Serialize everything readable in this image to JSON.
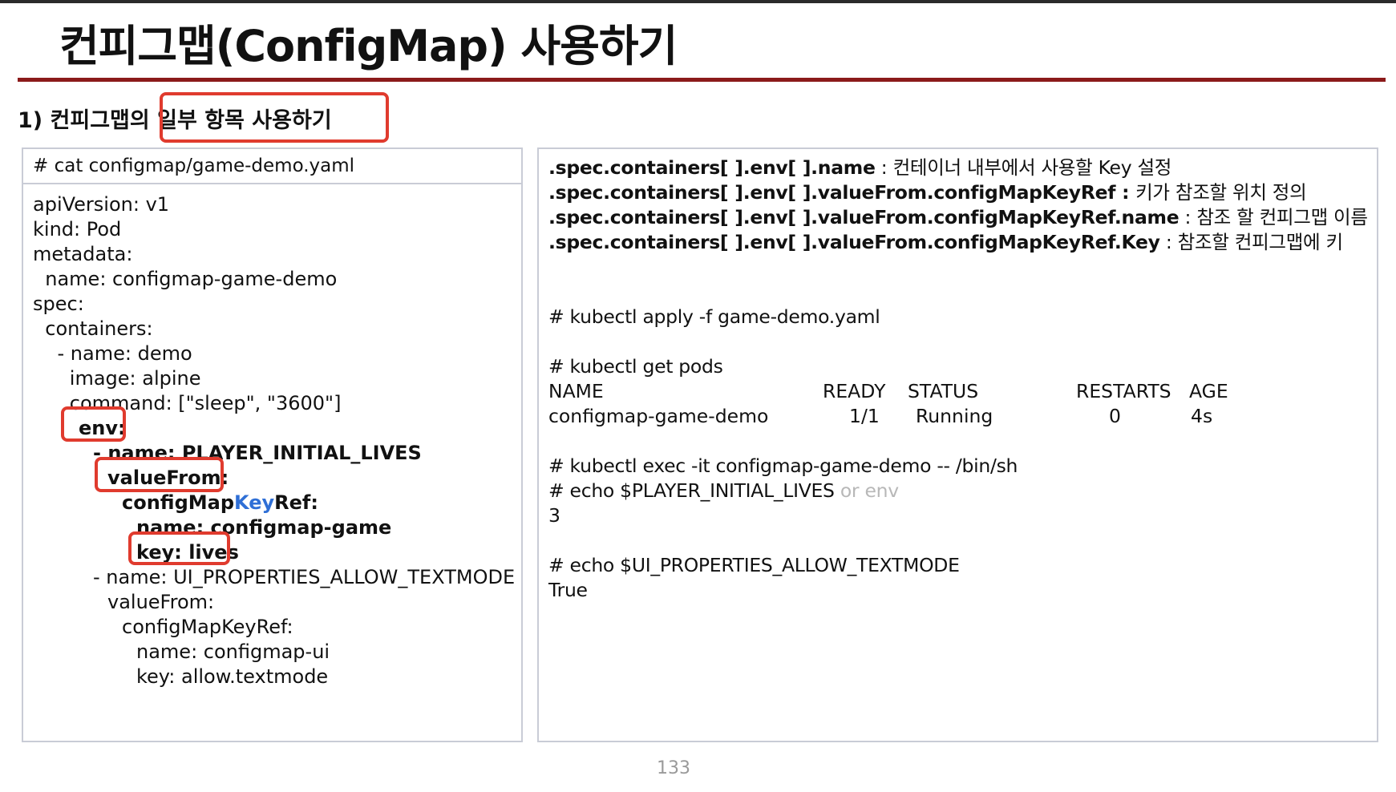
{
  "slide": {
    "title": "컨피그맵(ConfigMap) 사용하기",
    "subtitle_prefix": "1) 컨피그맵의 ",
    "subtitle_highlight": "일부 항목 사용하기",
    "page_number": "133",
    "accent_color": "#8b1a1a",
    "highlight_color": "#e03b2e"
  },
  "left_panel": {
    "header": "# cat configmap/game-demo.yaml",
    "lines": {
      "l1": "apiVersion: v1",
      "l2": "kind: Pod",
      "l3": "metadata:",
      "l4": "  name: configmap-game-demo",
      "l5": "spec:",
      "l6": "  containers:",
      "l7": "    - name: demo",
      "l8": "      image: alpine",
      "l9": "      command: [\"sleep\", \"3600\"]",
      "l10": "env:",
      "l11": "- name: PLAYER_INITIAL_LIVES",
      "l12": "valueFrom:",
      "l13_a": "configMap",
      "l13_b": "Key",
      "l13_c": "Ref:",
      "l14": "name: configmap-game",
      "l15": "key: lives",
      "l16": "- name: UI_PROPERTIES_ALLOW_TEXTMODE",
      "l17": "valueFrom:",
      "l18": "configMapKeyRef:",
      "l19": "name: configmap-ui",
      "l20": "key: allow.textmode"
    }
  },
  "right_panel": {
    "specs": [
      {
        "key": ".spec.containers[ ].env[ ].name",
        "sep": " : ",
        "desc": "컨테이너 내부에서 사용할 Key 설정"
      },
      {
        "key": ".spec.containers[ ].env[ ].valueFrom.configMapKeyRef",
        "sep": " : ",
        "desc": "키가 참조할 위치 정의"
      },
      {
        "key": ".spec.containers[ ].env[ ].valueFrom.configMapKeyRef.name",
        "sep": " : ",
        "desc": "참조 할 컨피그맵 이름"
      },
      {
        "key": ".spec.containers[ ].env[ ].valueFrom.configMapKeyRef.Key",
        "sep": " : ",
        "desc": "참조할 컨피그맵에 키"
      }
    ],
    "cmd_apply": "# kubectl apply -f game-demo.yaml",
    "cmd_get_pods": "# kubectl get pods",
    "table": {
      "headers": [
        "NAME",
        "READY",
        "STATUS",
        "RESTARTS",
        "AGE"
      ],
      "row": [
        "configmap-game-demo",
        "1/1",
        "Running",
        "0",
        "4s"
      ]
    },
    "cmd_exec": "# kubectl exec -it configmap-game-demo -- /bin/sh",
    "cmd_echo_lives": "# echo $PLAYER_INITIAL_LIVES",
    "echo_hint": "or env",
    "out_lives": "3",
    "cmd_echo_textmode": "# echo $UI_PROPERTIES_ALLOW_TEXTMODE",
    "out_textmode": "True"
  }
}
